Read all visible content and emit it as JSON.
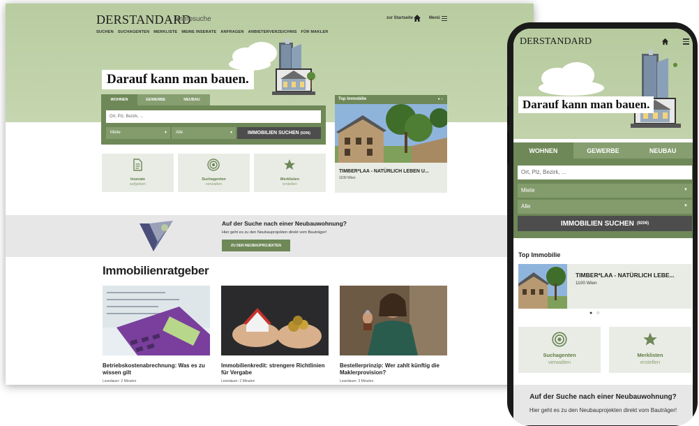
{
  "desktop": {
    "logo": "DERSTANDARD",
    "logo_sep": "›",
    "logo_sub": "Immosuche",
    "start_label": "zur Startseite",
    "menu_label": "Menü",
    "nav": [
      "SUCHEN",
      "SUCHAGENTEN",
      "MERKLISTE",
      "MEINE INSERATE",
      "ANFRAGEN",
      "ANBIETERVERZEICHNIS",
      "FÜR MAKLER"
    ],
    "slogan": "Darauf kann man bauen.",
    "tabs": [
      "WOHNEN",
      "GEWERBE",
      "NEUBAU"
    ],
    "search_placeholder": "Ort, Plz, Bezirk, ...",
    "select_type": "Miete",
    "select_kind": "Alle",
    "search_button": "IMMOBILIEN SUCHEN",
    "search_count": "(9206)",
    "tiles": [
      {
        "l1": "Inserate",
        "l2": "aufgeben"
      },
      {
        "l1": "Suchagenten",
        "l2": "verwalten"
      },
      {
        "l1": "Merklisten",
        "l2": "erstellen"
      }
    ],
    "top_label": "Top Immobilie",
    "top_dots": "● ○",
    "top_title": "TIMBER*LAA - NATÜRLICH LEBEN U...",
    "top_location": "1100 Wien",
    "band_title": "Auf der Suche nach einer Neubauwohnung?",
    "band_text": "Hier geht es zu den Neubauprojekten direkt vom Bauträger!",
    "band_button": "ZU DEN NEUBAUPROJEKTEN",
    "ratgeber_title": "Immobilienratgeber",
    "articles": [
      {
        "title": "Betriebskostenabrechnung: Was es zu wissen gilt",
        "meta": "Lesedauer: 2 Minuten"
      },
      {
        "title": "Immobilienkredit: strengere Richtlinien für Vergabe",
        "meta": "Lesedauer: 2 Minuten"
      },
      {
        "title": "Bestellerprinzip: Wer zahlt künftig die Maklerprovision?",
        "meta": "Lesedauer: 3 Minuten"
      }
    ]
  },
  "mobile": {
    "logo": "DERSTANDARD",
    "slogan": "Darauf kann man bauen.",
    "tabs": [
      "WOHNEN",
      "GEWERBE",
      "NEUBAU"
    ],
    "search_placeholder": "Ort, Plz, Bezirk, ...",
    "select_type": "Miete",
    "select_kind": "Alle",
    "search_button": "IMMOBILIEN SUCHEN",
    "search_count": "(9206)",
    "top_label": "Top Immobilie",
    "top_title": "TIMBER*LAA - NATÜRLICH LEBE...",
    "top_location": "1100 Wien",
    "dots": "● ○",
    "tiles": [
      {
        "l1": "Suchagenten",
        "l2": "verwalten"
      },
      {
        "l1": "Merklisten",
        "l2": "erstellen"
      }
    ],
    "band_title": "Auf der Suche nach einer Neubauwohnung?",
    "band_text": "Hier geht es zu den Neubauprojekten direkt vom Bauträger!"
  },
  "colors": {
    "brand_green": "#6e8857",
    "light_green": "#b8cca0",
    "dark_button": "#4d4d4d"
  }
}
